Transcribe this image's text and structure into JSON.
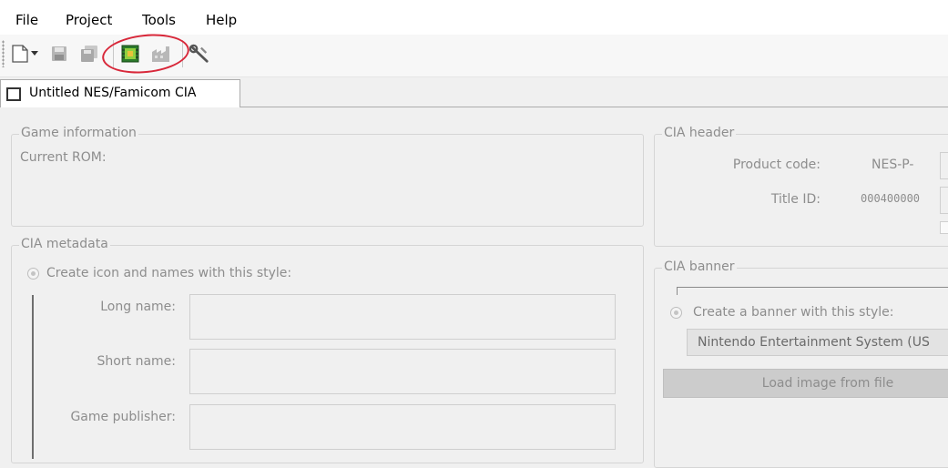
{
  "menu": {
    "file": "File",
    "project": "Project",
    "tools": "Tools",
    "help": "Help"
  },
  "toolbar": {
    "icons": [
      "new-file-icon",
      "dropdown-arrow-icon",
      "save-icon",
      "save-all-icon",
      "build-cia-icon",
      "build-disabled-icon",
      "tools-icon"
    ]
  },
  "tab": {
    "label": "Untitled NES/Famicom CIA"
  },
  "game_info": {
    "title": "Game information",
    "current_rom_label": "Current ROM:"
  },
  "cia_metadata": {
    "title": "CIA metadata",
    "radio_label": "Create icon and names with this style:",
    "long_name_label": "Long name:",
    "short_name_label": "Short name:",
    "publisher_label": "Game publisher:"
  },
  "cia_header": {
    "title": "CIA header",
    "product_code_label": "Product code:",
    "product_code_prefix": "NES-P-",
    "title_id_label": "Title ID:",
    "title_id_prefix": "000400000"
  },
  "cia_banner": {
    "title": "CIA banner",
    "radio_label": "Create a banner with this style:",
    "style_value": "Nintendo Entertainment System (US",
    "load_button": "Load image from file"
  },
  "colors": {
    "annotation": "#d8283a",
    "disabled_text": "#8d8d8d"
  }
}
